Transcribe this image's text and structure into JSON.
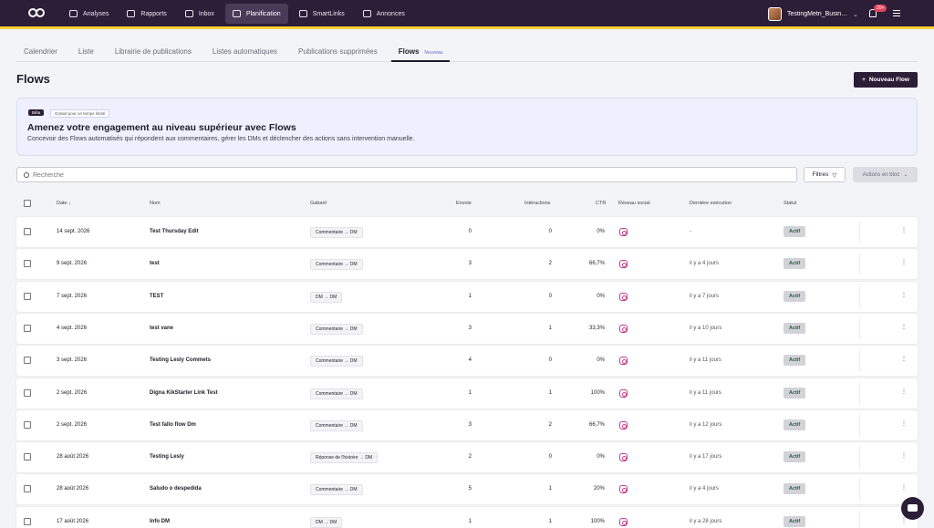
{
  "topbar": {
    "nav": [
      {
        "label": "Analyses",
        "icon": "analytics-icon"
      },
      {
        "label": "Rapports",
        "icon": "reports-icon"
      },
      {
        "label": "Inbox",
        "icon": "inbox-icon"
      },
      {
        "label": "Planification",
        "icon": "calendar-icon",
        "active": true
      },
      {
        "label": "SmartLinks",
        "icon": "link-icon"
      },
      {
        "label": "Annonces",
        "icon": "megaphone-icon"
      }
    ],
    "user_name": "TestingMetri_Busin…",
    "notification_badge": "20+"
  },
  "subtabs": [
    {
      "label": "Calendrier"
    },
    {
      "label": "Liste"
    },
    {
      "label": "Librairie de publications"
    },
    {
      "label": "Listes automatiques"
    },
    {
      "label": "Publications supprimées"
    },
    {
      "label": "Flows",
      "tag": "Nouveau",
      "active": true
    }
  ],
  "page_title": "Flows",
  "new_flow_button": "Nouveau Flow",
  "banner": {
    "beta": "Bêta",
    "free": "Gratuit pour un temps limité",
    "title": "Amenez votre engagement au niveau supérieur avec Flows",
    "description": "Concevoir des Flows automatisés qui répondent aux commentaires, gérer les DMs et déclencher des actions sans intervention manuelle."
  },
  "search": {
    "placeholder": "Recherche"
  },
  "filters_label": "Filtres",
  "bulk_label": "Actions en bloc",
  "table": {
    "headers": {
      "date": "Date",
      "name": "Nom",
      "template": "Gabarit",
      "sent": "Envoie",
      "interactions": "Intéractions",
      "ctr": "CTR",
      "network": "Réseau social",
      "last_run": "Dernière exécution",
      "status": "Statut"
    },
    "rows": [
      {
        "date": "14 sept. 2026",
        "name": "Test Thursday Edit",
        "template": "Commentaire → DM",
        "sent": "0",
        "interactions": "0",
        "ctr": "0%",
        "last_run": "-",
        "status": "Actif"
      },
      {
        "date": "9 sept. 2026",
        "name": "test",
        "template": "Commentaire → DM",
        "sent": "3",
        "interactions": "2",
        "ctr": "66,7%",
        "last_run": "il y a 4 jours",
        "status": "Actif"
      },
      {
        "date": "7 sept. 2026",
        "name": "TEST",
        "template": "DM → DM",
        "sent": "1",
        "interactions": "0",
        "ctr": "0%",
        "last_run": "il y a 7 jours",
        "status": "Actif"
      },
      {
        "date": "4 sept. 2026",
        "name": "test vane",
        "template": "Commentaire → DM",
        "sent": "3",
        "interactions": "1",
        "ctr": "33,3%",
        "last_run": "il y a 10 jours",
        "status": "Actif"
      },
      {
        "date": "3 sept. 2026",
        "name": "Testing Lesly Commets",
        "template": "Commentaire → DM",
        "sent": "4",
        "interactions": "0",
        "ctr": "0%",
        "last_run": "il y a 11 jours",
        "status": "Actif"
      },
      {
        "date": "2 sept. 2026",
        "name": "Digna KikStarter Link Test",
        "template": "Commentaire → DM",
        "sent": "1",
        "interactions": "1",
        "ctr": "100%",
        "last_run": "il y a 11 jours",
        "status": "Actif"
      },
      {
        "date": "2 sept. 2026",
        "name": "Test fallo flow Dm",
        "template": "Commentaire → DM",
        "sent": "3",
        "interactions": "2",
        "ctr": "66,7%",
        "last_run": "il y a 12 jours",
        "status": "Actif"
      },
      {
        "date": "28 août 2026",
        "name": "Testing Lesly",
        "template": "Réponse de l'histoire → DM",
        "sent": "2",
        "interactions": "0",
        "ctr": "0%",
        "last_run": "il y a 17 jours",
        "status": "Actif"
      },
      {
        "date": "28 août 2026",
        "name": "Saludo o despedida",
        "template": "Commentaire → DM",
        "sent": "5",
        "interactions": "1",
        "ctr": "20%",
        "last_run": "il y a 4 jours",
        "status": "Actif"
      },
      {
        "date": "17 août 2026",
        "name": "Info DM",
        "template": "DM → DM",
        "sent": "1",
        "interactions": "1",
        "ctr": "100%",
        "last_run": "il y a 28 jours",
        "status": "Actif"
      }
    ]
  }
}
